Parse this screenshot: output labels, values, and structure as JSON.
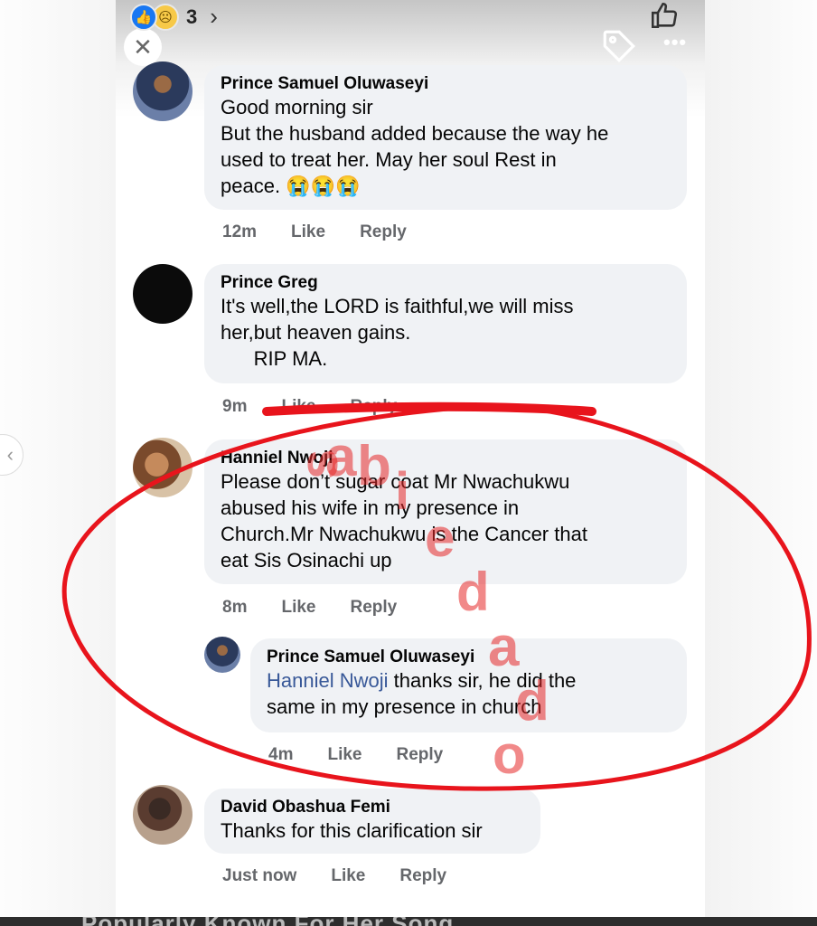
{
  "top_bar": {
    "reaction_count": "3",
    "chevron": "›",
    "icons": {
      "like": "thumbs-up-icon",
      "sad": "sad-face-icon",
      "tag": "tag-icon",
      "more": "more-options-icon",
      "close": "close-icon"
    },
    "close_glyph": "✕",
    "more_glyph": "•••"
  },
  "comments": [
    {
      "author": "Prince Samuel Oluwaseyi",
      "lines": [
        "Good morning sir",
        "But the husband added because the way he",
        "used to treat her. May her soul Rest in",
        "peace. 😭😭😭"
      ],
      "time": "12m",
      "like": "Like",
      "reply": "Reply"
    },
    {
      "author": "Prince Greg",
      "lines": [
        "It's well,the LORD is faithful,we will miss",
        "her,but heaven gains.",
        "      RIP MA."
      ],
      "time": "9m",
      "like": "Like",
      "reply": "Reply"
    },
    {
      "author": "Hanniel Nwoji",
      "lines": [
        "Please don’t sugar coat Mr Nwachukwu",
        "abused his wife in my presence in",
        "Church.Mr Nwachukwu is the Cancer that",
        "eat Sis Osinachi up"
      ],
      "time": "8m",
      "like": "Like",
      "reply": "Reply"
    },
    {
      "author": "Prince Samuel Oluwaseyi",
      "mention": "Hanniel Nwoji",
      "lines": [
        " thanks sir, he did the",
        "same in my presence in church"
      ],
      "time": "4m",
      "like": "Like",
      "reply": "Reply"
    },
    {
      "author": "David Obashua Femi",
      "lines": [
        "Thanks for this clarification sir"
      ],
      "time": "Just now",
      "like": "Like",
      "reply": "Reply"
    }
  ],
  "watermark": {
    "text": "sabiedad",
    "color": "#e62828"
  },
  "annotation_color": "#e8141c",
  "footer_partial_text": "Popularly Known For Her Song"
}
